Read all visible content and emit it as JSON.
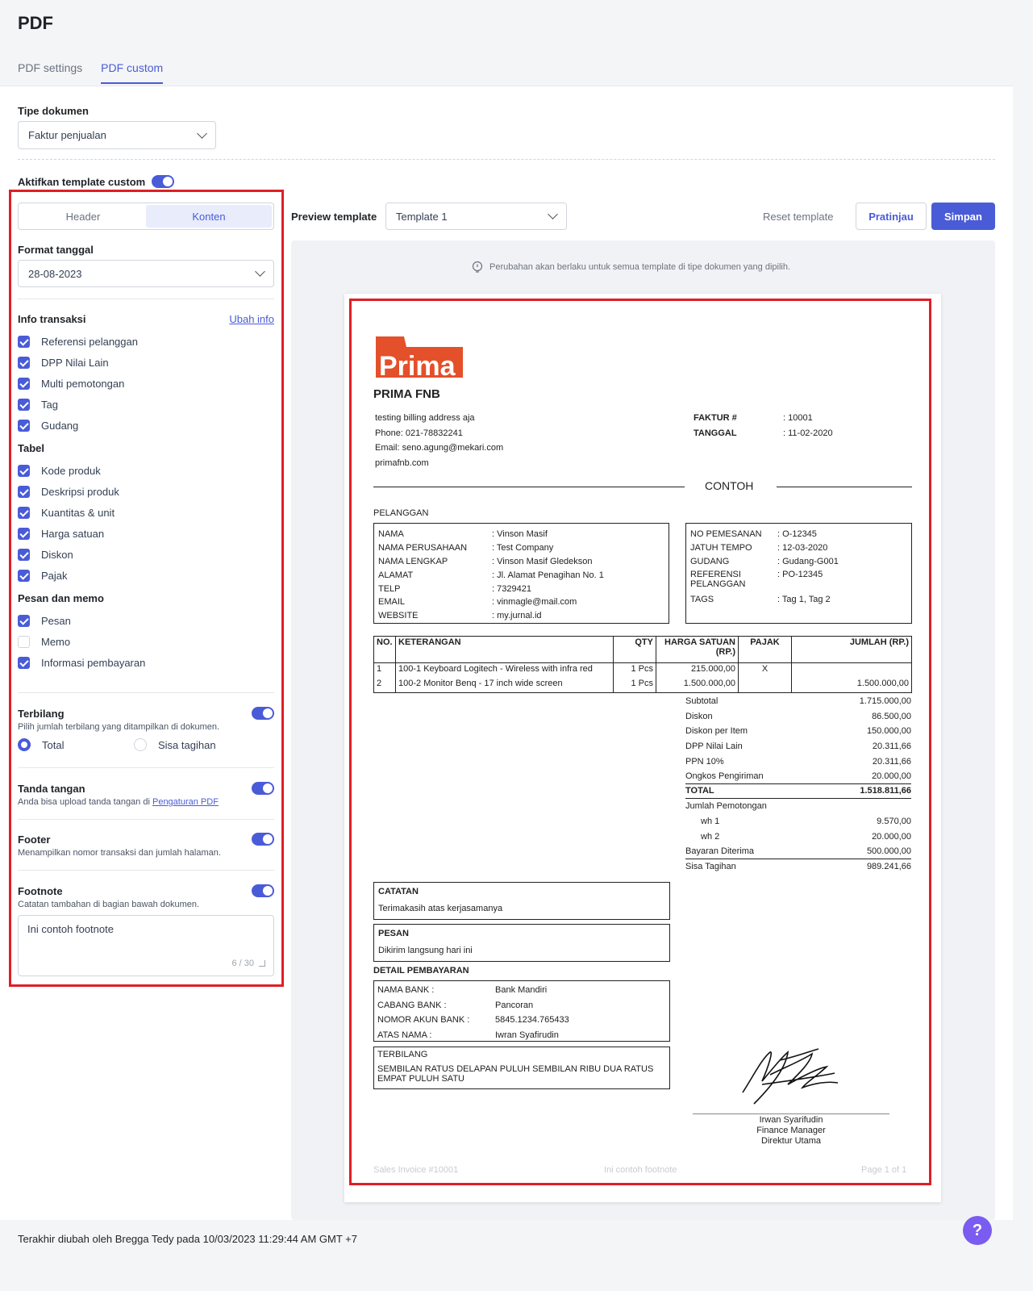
{
  "page": {
    "title": "PDF"
  },
  "tabs": [
    {
      "label": "PDF settings"
    },
    {
      "label": "PDF custom"
    }
  ],
  "doc_type": {
    "label": "Tipe dokumen",
    "value": "Faktur penjualan"
  },
  "custom_template": {
    "label": "Aktifkan template custom"
  },
  "segment": {
    "header": "Header",
    "konten": "Konten"
  },
  "format_tanggal": {
    "label": "Format tanggal",
    "value": "28-08-2023"
  },
  "info_transaksi": {
    "title": "Info transaksi",
    "edit_link": "Ubah info",
    "items": [
      "Referensi pelanggan",
      "DPP Nilai Lain",
      "Multi pemotongan",
      "Tag",
      "Gudang"
    ]
  },
  "tabel": {
    "title": "Tabel",
    "items": [
      "Kode produk",
      "Deskripsi produk",
      "Kuantitas & unit",
      "Harga satuan",
      "Diskon",
      "Pajak"
    ]
  },
  "pesan_memo": {
    "title": "Pesan dan memo",
    "items": [
      "Pesan",
      "Memo",
      "Informasi pembayaran"
    ]
  },
  "terbilang": {
    "title": "Terbilang",
    "desc": "Pilih jumlah terbilang yang ditampilkan di dokumen.",
    "opt_total": "Total",
    "opt_sisa": "Sisa tagihan"
  },
  "tanda_tangan": {
    "title": "Tanda tangan",
    "desc": "Anda bisa upload tanda tangan di",
    "link": "Pengaturan PDF"
  },
  "footer": {
    "title": "Footer",
    "desc": "Menampilkan nomor transaksi dan jumlah halaman."
  },
  "footnote": {
    "title": "Footnote",
    "desc": "Catatan tambahan di bagian bawah dokumen.",
    "value": "Ini contoh footnote",
    "counter": "6 / 30"
  },
  "preview": {
    "label": "Preview template",
    "template": "Template 1",
    "reset": "Reset template",
    "pratinjau": "Pratinjau",
    "simpan": "Simpan",
    "notice": "Perubahan akan berlaku untuk semua template di tipe dokumen yang dipilih."
  },
  "invoice": {
    "logo_text": "Prima",
    "company": "PRIMA FNB",
    "address": [
      "testing billing address aja",
      "Phone: 021-78832241",
      "Email: seno.agung@mekari.com",
      "primafnb.com"
    ],
    "faktur_label": "FAKTUR #",
    "faktur_value": ": 10001",
    "tanggal_label": "TANGGAL",
    "tanggal_value": ": 11-02-2020",
    "contoh": "CONTOH",
    "pelanggan": "PELANGGAN",
    "customer": [
      {
        "k": "NAMA",
        "v": ": Vinson Masif"
      },
      {
        "k": "NAMA PERUSAHAAN",
        "v": ": Test Company"
      },
      {
        "k": "NAMA LENGKAP",
        "v": ": Vinson Masif Gledekson"
      },
      {
        "k": "ALAMAT",
        "v": ": Jl. Alamat Penagihan No. 1"
      },
      {
        "k": "TELP",
        "v": ": 7329421"
      },
      {
        "k": "EMAIL",
        "v": ": vinmagle@mail.com"
      },
      {
        "k": "WEBSITE",
        "v": ": my.jurnal.id"
      }
    ],
    "order": [
      {
        "k": "NO PEMESANAN",
        "v": ": O-12345"
      },
      {
        "k": "JATUH TEMPO",
        "v": ": 12-03-2020"
      },
      {
        "k": "GUDANG",
        "v": ": Gudang-G001"
      },
      {
        "k": "REFERENSI PELANGGAN",
        "v": ": PO-12345"
      },
      {
        "k": "TAGS",
        "v": ": Tag 1, Tag 2"
      }
    ],
    "table_head": {
      "no": "NO.",
      "ket": "KETERANGAN",
      "qty": "QTY",
      "harga": "HARGA SATUAN (RP.)",
      "pajak": "PAJAK",
      "jumlah": "JUMLAH (RP.)"
    },
    "rows": [
      {
        "no": "1",
        "ket": "100-1 Keyboard Logitech - Wireless with infra red",
        "qty": "1 Pcs",
        "harga": "215.000,00",
        "pajak": "X",
        "jumlah": ""
      },
      {
        "no": "2",
        "ket": "100-2 Monitor Benq - 17 inch wide screen",
        "qty": "1 Pcs",
        "harga": "1.500.000,00",
        "pajak": "",
        "jumlah": "1.500.000,00"
      }
    ],
    "totals": [
      {
        "k": "Subtotal",
        "v": "1.715.000,00"
      },
      {
        "k": "Diskon",
        "v": "86.500,00"
      },
      {
        "k": "Diskon per Item",
        "v": "150.000,00"
      },
      {
        "k": "DPP Nilai Lain",
        "v": "20.311,66"
      },
      {
        "k": "PPN 10%",
        "v": "20.311,66"
      },
      {
        "k": "Ongkos Pengiriman",
        "v": "20.000,00"
      }
    ],
    "total": {
      "k": "TOTAL",
      "v": "1.518.811,66"
    },
    "potongan": {
      "k": "Jumlah Pemotongan"
    },
    "wh": [
      {
        "k": "wh 1",
        "v": "9.570,00"
      },
      {
        "k": "wh 2",
        "v": "20.000,00"
      }
    ],
    "bayaran": {
      "k": "Bayaran Diterima",
      "v": "500.000,00"
    },
    "sisa": {
      "k": "Sisa Tagihan",
      "v": "989.241,66"
    },
    "catatan": {
      "title": "CATATAN",
      "text": "Terimakasih atas kerjasamanya"
    },
    "pesan": {
      "title": "PESAN",
      "text": "Dikirim langsung hari ini"
    },
    "detail_title": "DETAIL PEMBAYARAN",
    "bank": [
      {
        "k": "NAMA BANK :",
        "v": "Bank Mandiri"
      },
      {
        "k": "CABANG BANK :",
        "v": "Pancoran"
      },
      {
        "k": "NOMOR AKUN BANK :",
        "v": "5845.1234.765433"
      },
      {
        "k": "ATAS NAMA :",
        "v": "Iwran Syafirudin"
      }
    ],
    "terbilang": {
      "title": "TERBILANG",
      "text": "SEMBILAN RATUS DELAPAN PULUH SEMBILAN RIBU DUA RATUS EMPAT PULUH SATU"
    },
    "signer": [
      "Irwan Syarifudin",
      "Finance Manager",
      "Direktur Utama"
    ],
    "foot_left": "Sales Invoice #10001",
    "foot_mid": "Ini contoh footnote",
    "foot_right": "Page 1 of 1"
  },
  "last_modified": "Terakhir diubah oleh Bregga Tedy pada 10/03/2023 11:29:44 AM GMT +7",
  "help": "?"
}
